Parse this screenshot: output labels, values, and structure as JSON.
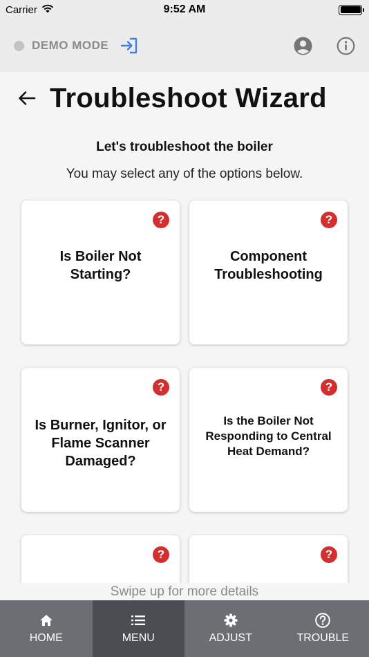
{
  "status_bar": {
    "carrier": "Carrier",
    "time": "9:52 AM"
  },
  "header": {
    "demo_label": "DEMO MODE",
    "icons": [
      "exit-icon",
      "account-icon",
      "info-icon"
    ],
    "accent_color": "#3f7fe0"
  },
  "page": {
    "title": "Troubleshoot Wizard",
    "subtitle": "Let's troubleshoot the boiler",
    "instructions": "You may select any of the options below."
  },
  "cards": [
    {
      "label": "Is Boiler Not Starting?",
      "help": "?"
    },
    {
      "label": "Component Troubleshooting",
      "help": "?"
    },
    {
      "label": "Is Burner, Ignitor, or Flame Scanner Damaged?",
      "help": "?"
    },
    {
      "label": "Is the Boiler Not Responding to Central Heat Demand?",
      "help": "?"
    },
    {
      "label": "",
      "help": "?"
    },
    {
      "label": "",
      "help": "?"
    }
  ],
  "swipe_hint": "Swipe up for more details",
  "nav": {
    "items": [
      {
        "label": "HOME",
        "icon": "home-icon",
        "active": false
      },
      {
        "label": "MENU",
        "icon": "menu-icon",
        "active": true
      },
      {
        "label": "ADJUST",
        "icon": "gear-icon",
        "active": false
      },
      {
        "label": "TROUBLE",
        "icon": "help-circle-icon",
        "active": false
      }
    ]
  },
  "colors": {
    "help_badge": "#d32f2f",
    "nav_bg": "#6b6f73",
    "nav_active": "#4a4e52"
  }
}
